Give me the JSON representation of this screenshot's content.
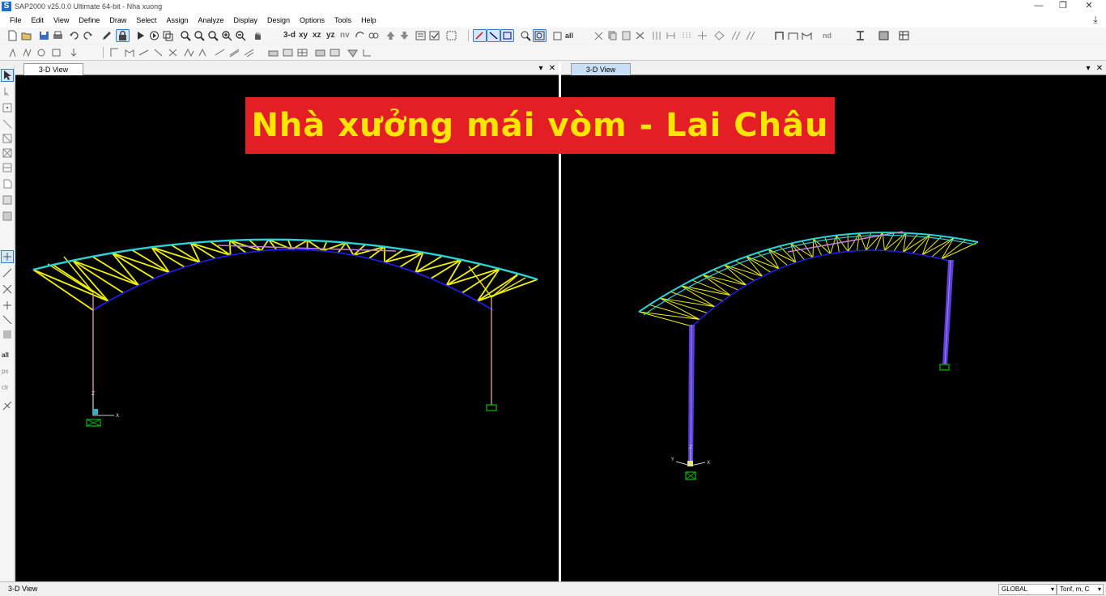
{
  "window": {
    "app_logo": "S",
    "title": "SAP2000 v25.0.0 Ultimate 64-bit - Nha xuong",
    "controls": [
      "—",
      "❐",
      "✕"
    ]
  },
  "menu": [
    "File",
    "Edit",
    "View",
    "Define",
    "Draw",
    "Select",
    "Assign",
    "Analyze",
    "Display",
    "Design",
    "Options",
    "Tools",
    "Help"
  ],
  "toolbar": {
    "view_labels": [
      "3-d",
      "xy",
      "xz",
      "yz",
      "nv"
    ],
    "all_label": "all",
    "nd_label": "nd"
  },
  "left_toolbar": {
    "all_label": "all",
    "ps_label": "ps",
    "clr_label": "clr"
  },
  "panes": [
    {
      "tab_label": "3-D View",
      "axes": {
        "z": "Z",
        "x": "X"
      }
    },
    {
      "tab_label": "3-D View",
      "axes": {
        "z": "Z",
        "x": "X",
        "y": "Y"
      }
    }
  ],
  "pane_controls": {
    "dropdown": "▾",
    "close": "✕"
  },
  "banner": {
    "text": "Nhà xưởng mái vòm - Lai Châu"
  },
  "status": {
    "view": "3-D View",
    "coord_system": "GLOBAL",
    "units": "Tonf, m, C"
  },
  "colors": {
    "chord_top": "#2ad4d4",
    "web": "#f0f000",
    "chord_bottom": "#2020ff",
    "tie": "#c080e0",
    "column": "#e8a0a0",
    "column_3d": "#6a4bff",
    "support": "#00c000",
    "banner_bg": "#e31e24",
    "banner_text": "#ffe600"
  }
}
